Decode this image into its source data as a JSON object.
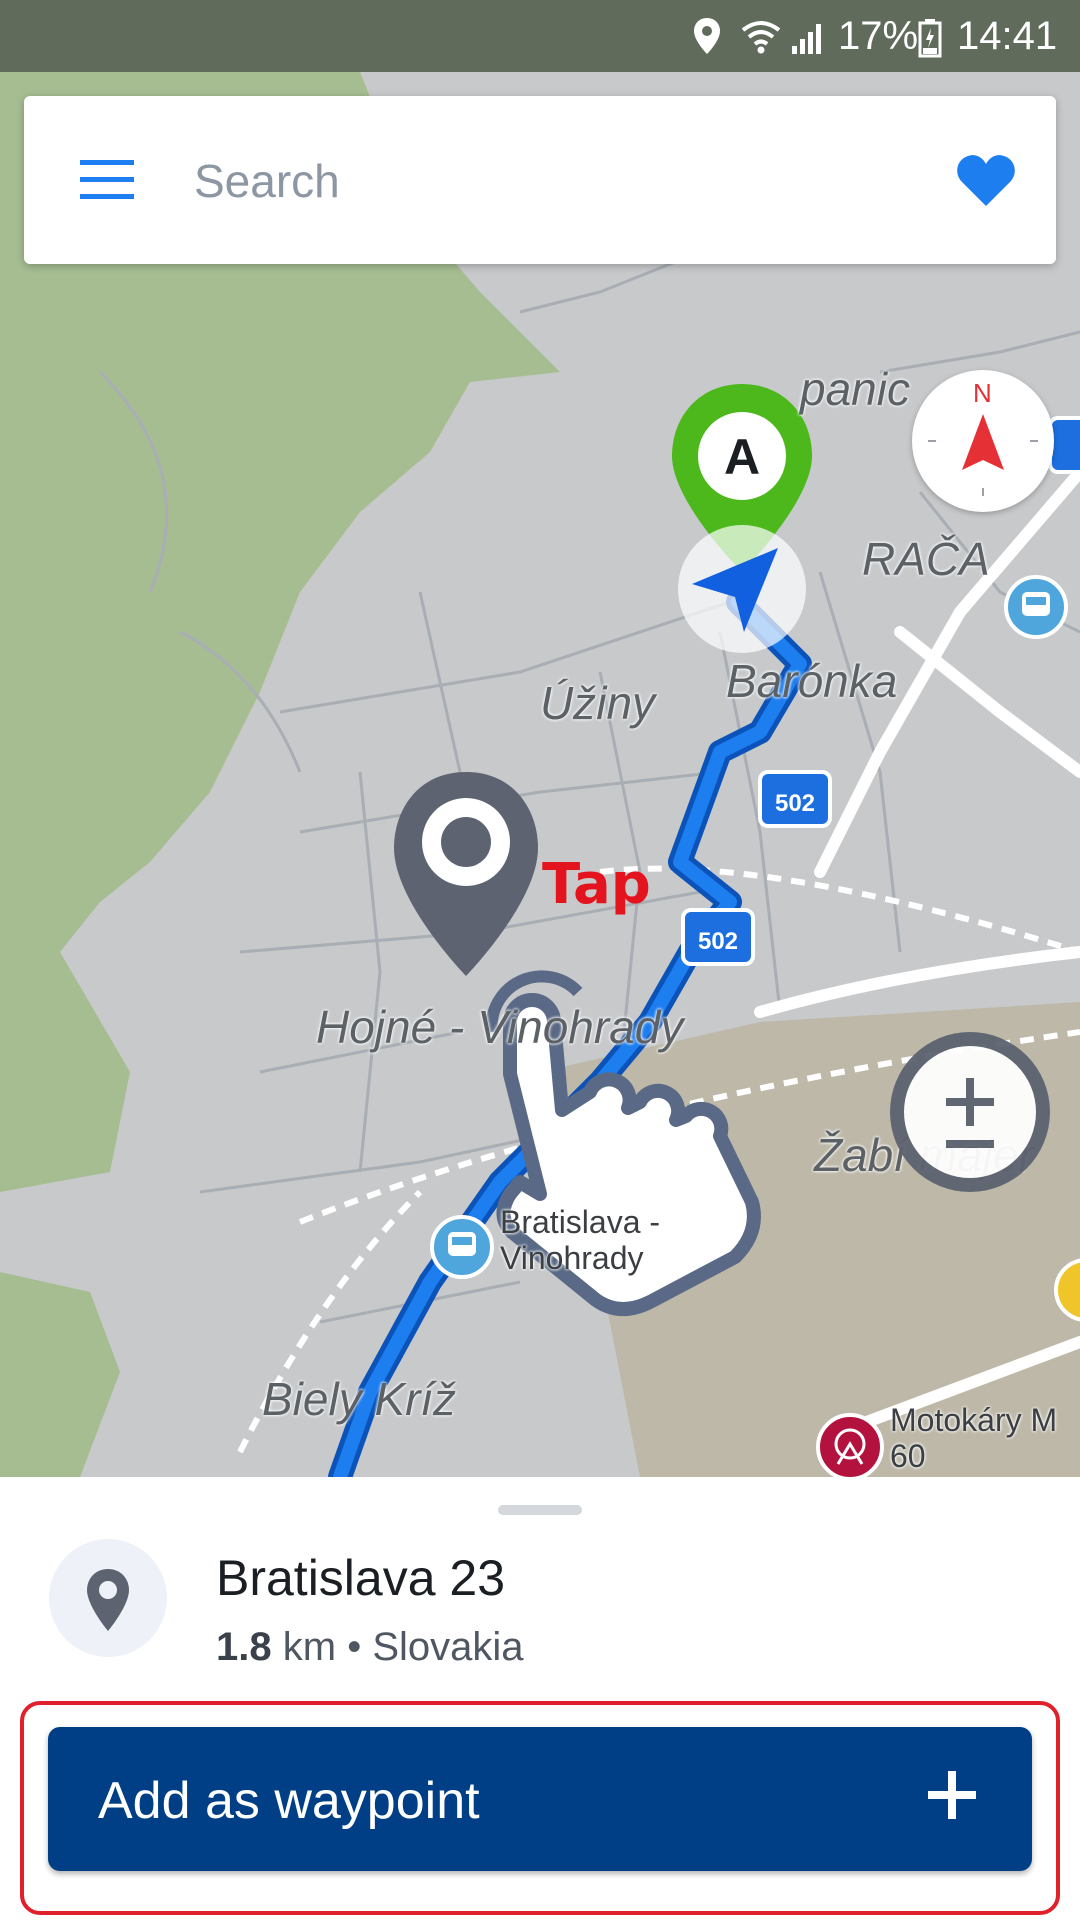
{
  "status_bar": {
    "battery": "17%",
    "time": "14:41",
    "icons": [
      "location-icon",
      "wifi-icon",
      "signal-icon",
      "battery-icon"
    ]
  },
  "search": {
    "placeholder": "Search",
    "value": "",
    "icons": [
      "menu-icon",
      "heart-icon"
    ]
  },
  "map": {
    "labels": {
      "rača": "RAČA",
      "baronka": "Barónka",
      "uziny": "Úžiny",
      "hojne": "Hojné - Vinohrady",
      "zabi": "Žabí majer",
      "biely": "Biely Kríž",
      "panic": "panic"
    },
    "road_shields": [
      "502",
      "502"
    ],
    "start_marker": "A",
    "pois": {
      "station": "Bratislava - Vinohrady",
      "motokary": "Motokáry M 60"
    },
    "tap_hint": "Tap",
    "compass_label": "N",
    "route_color": "#1d7ef0",
    "forest_color": "#a6bd92"
  },
  "place": {
    "name": "Bratislava 23",
    "distance_value": "1.8",
    "distance_unit": "km",
    "separator": "•",
    "country": "Slovakia"
  },
  "actions": {
    "add_waypoint": "Add as waypoint"
  },
  "colors": {
    "accent": "#003f86",
    "highlight": "#e0202a",
    "start_marker": "#4cb81c"
  }
}
